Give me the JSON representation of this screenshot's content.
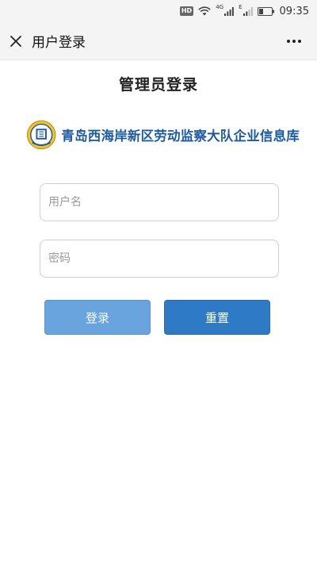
{
  "status_bar": {
    "hd": "HD",
    "network1": "4G",
    "network2": "E",
    "time": "09:35"
  },
  "nav": {
    "title": "用户登录",
    "close_icon": "close-icon",
    "more_icon": "more-icon"
  },
  "page": {
    "heading": "管理员登录",
    "banner_text": "青岛西海岸新区劳动监察大队企业信息库"
  },
  "form": {
    "username_placeholder": "用户名",
    "username_value": "",
    "password_placeholder": "密码",
    "password_value": "",
    "login_label": "登录",
    "reset_label": "重置"
  },
  "colors": {
    "login_button": "#6aa4de",
    "reset_button": "#2f7ac4",
    "banner_text": "#1f5b9c"
  }
}
